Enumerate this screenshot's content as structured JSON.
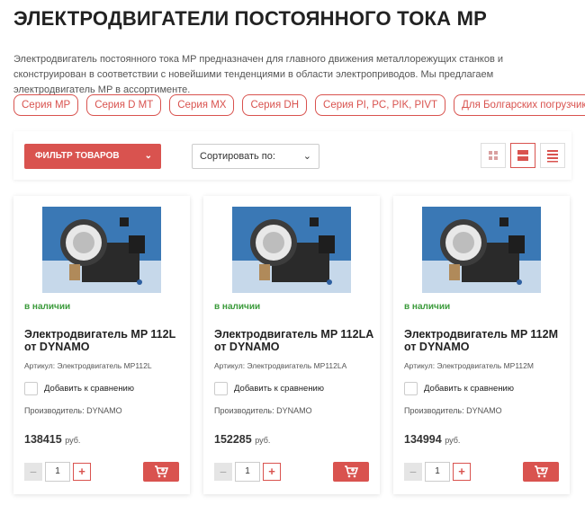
{
  "page": {
    "title": "ЭЛЕКТРОДВИГАТЕЛИ ПОСТОЯННОГО ТОКА MP",
    "description": "Электродвигатель постоянного тока MP предназначен для главного движения металлорежущих станков и сконструирован в соответствии с новейшими тенденциями в области электроприводов. Мы предлагаем электродвигатель MP в ассортименте."
  },
  "series": [
    "Серия MP",
    "Серия D MT",
    "Серия MX",
    "Серия DH",
    "Серия PI, PC, PIK, PIVT",
    "Для Болгарских погрузчиков"
  ],
  "toolbar": {
    "filter_label": "ФИЛЬТР ТОВАРОВ",
    "sort_label": "Сортировать по:",
    "accent_color": "#d9534f"
  },
  "products": [
    {
      "stock": "в наличии",
      "title": "Электродвигатель MP 112L от DYNAMO",
      "sku": "Артикул: Электродвигатель MP112L",
      "compare_label": "Добавить к сравнению",
      "manufacturer": "Производитель: DYNAMO",
      "price": "138415",
      "currency": "руб.",
      "qty": "1"
    },
    {
      "stock": "в наличии",
      "title": "Электродвигатель MP 112LA от DYNAMO",
      "sku": "Артикул: Электродвигатель MP112LA",
      "compare_label": "Добавить к сравнению",
      "manufacturer": "Производитель: DYNAMO",
      "price": "152285",
      "currency": "руб.",
      "qty": "1"
    },
    {
      "stock": "в наличии",
      "title": "Электродвигатель MP 112M от DYNAMO",
      "sku": "Артикул: Электродвигатель MP112M",
      "compare_label": "Добавить к сравнению",
      "manufacturer": "Производитель: DYNAMO",
      "price": "134994",
      "currency": "руб.",
      "qty": "1"
    }
  ]
}
